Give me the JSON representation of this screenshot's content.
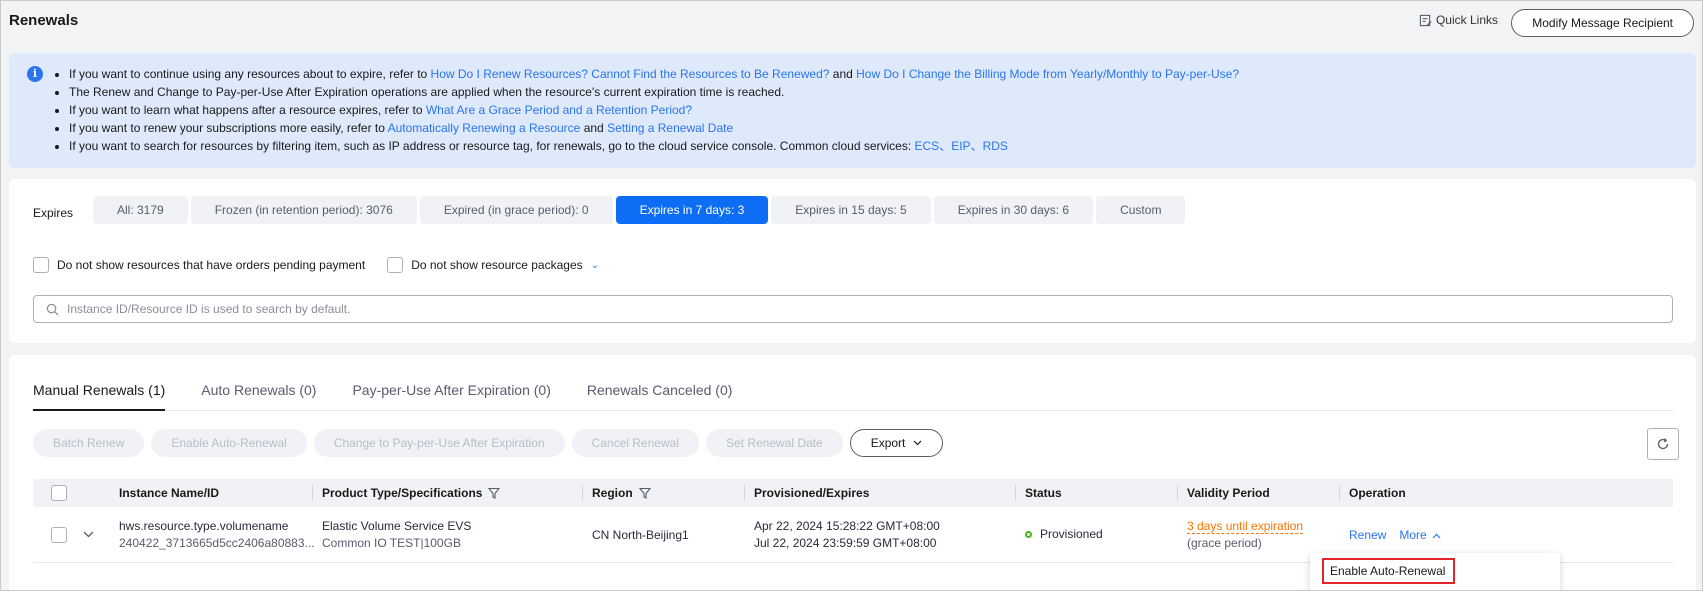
{
  "header": {
    "title": "Renewals",
    "quick_links": "Quick Links",
    "modify_button": "Modify Message Recipient"
  },
  "info": {
    "line1_prefix": "If you want to continue using any resources about to expire, refer to ",
    "line1_link1": "How Do I Renew Resources? Cannot Find the Resources to Be Renewed?",
    "line1_and": " and ",
    "line1_link2": "How Do I Change the Billing Mode from Yearly/Monthly to Pay-per-Use?",
    "line2": "The Renew and Change to Pay-per-Use After Expiration operations are applied when the resource's current expiration time is reached.",
    "line3_prefix": "If you want to learn what happens after a resource expires, refer to ",
    "line3_link": "What Are a Grace Period and a Retention Period?",
    "line4_prefix": "If you want to renew your subscriptions more easily, refer to ",
    "line4_link1": "Automatically Renewing a Resource",
    "line4_and": " and ",
    "line4_link2": "Setting a Renewal Date",
    "line5_prefix": "If you want to search for resources by filtering item, such as IP address or resource tag, for renewals, go to the cloud service console. Common cloud services: ",
    "line5_ecs": "ECS",
    "line5_sep1": "、",
    "line5_eip": "EIP",
    "line5_sep2": "、",
    "line5_rds": "RDS"
  },
  "filters": {
    "expires_label": "Expires",
    "chips": [
      "All: 3179",
      "Frozen (in retention period): 3076",
      "Expired (in grace period): 0",
      "Expires in 7 days: 3",
      "Expires in 15 days: 5",
      "Expires in 30 days: 6",
      "Custom"
    ],
    "active_chip": "Expires in 7 days: 3",
    "check_pending": "Do not show resources that have orders pending payment",
    "check_packages": "Do not show resource packages",
    "search_placeholder": "Instance ID/Resource ID is used to search by default."
  },
  "tabs": [
    "Manual Renewals (1)",
    "Auto Renewals (0)",
    "Pay-per-Use After Expiration (0)",
    "Renewals Canceled (0)"
  ],
  "actions": {
    "batch_renew": "Batch Renew",
    "enable_auto": "Enable Auto-Renewal",
    "change_ppu": "Change to Pay-per-Use After Expiration",
    "cancel_renewal": "Cancel Renewal",
    "set_date": "Set Renewal Date",
    "export": "Export"
  },
  "table": {
    "headers": {
      "name": "Instance Name/ID",
      "product": "Product Type/Specifications",
      "region": "Region",
      "provisioned": "Provisioned/Expires",
      "status": "Status",
      "validity": "Validity Period",
      "operation": "Operation"
    },
    "row": {
      "name": "hws.resource.type.volumename",
      "id": "240422_3713665d5cc2406a80883...",
      "product": "Elastic Volume Service EVS",
      "spec": "Common IO TEST|100GB",
      "region": "CN North-Beijing1",
      "provisioned": "Apr 22, 2024 15:28:22 GMT+08:00",
      "expires": "Jul 22, 2024 23:59:59 GMT+08:00",
      "status": "Provisioned",
      "validity": "3 days until expiration",
      "validity_note": "(grace period)",
      "renew": "Renew",
      "more": "More"
    }
  },
  "dropdown": {
    "enable_auto": "Enable Auto-Renewal"
  },
  "colors": {
    "accent": "#0d6ef5",
    "link": "#2a74ed",
    "warning": "#ff7400",
    "success": "#50b41e",
    "highlight_border": "#e0242a"
  }
}
